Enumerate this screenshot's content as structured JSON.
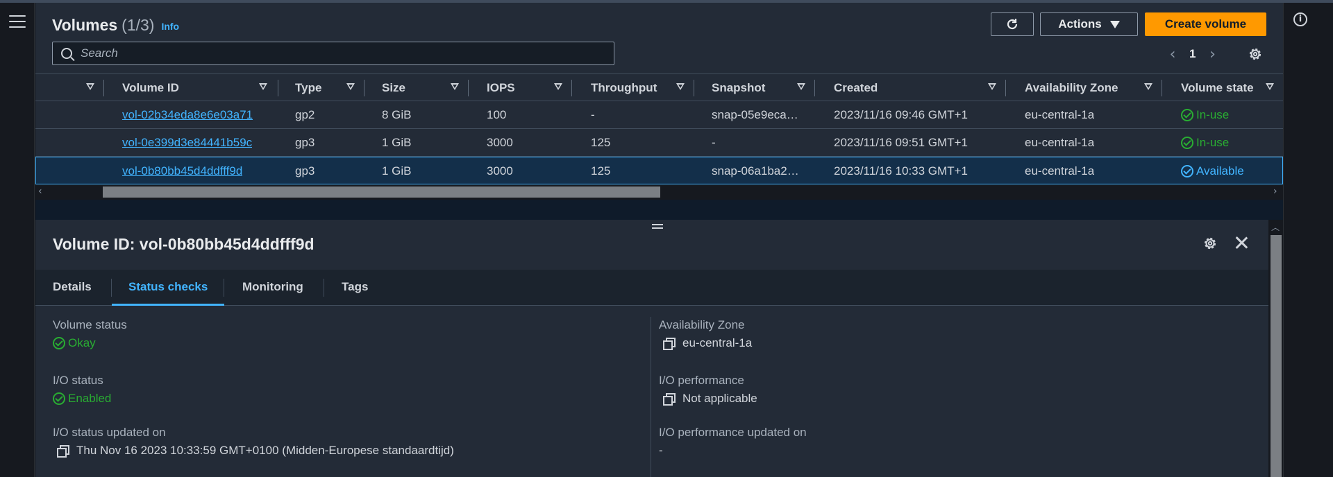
{
  "header": {
    "title": "Volumes",
    "count": "(1/3)",
    "info_label": "Info",
    "actions_label": "Actions",
    "create_label": "Create volume"
  },
  "search": {
    "placeholder": "Search"
  },
  "pagination": {
    "current_page": "1"
  },
  "table": {
    "columns": [
      "Volume ID",
      "Type",
      "Size",
      "IOPS",
      "Throughput",
      "Snapshot",
      "Created",
      "Availability Zone",
      "Volume state"
    ],
    "rows": [
      {
        "volume_id": "vol-02b34eda8e6e03a71",
        "type": "gp2",
        "size": "8 GiB",
        "iops": "100",
        "throughput": "-",
        "snapshot": "snap-05e9eca…",
        "created": "2023/11/16 09:46 GMT+1",
        "az": "eu-central-1a",
        "state": "In-use",
        "selected": false
      },
      {
        "volume_id": "vol-0e399d3e84441b59c",
        "type": "gp3",
        "size": "1 GiB",
        "iops": "3000",
        "throughput": "125",
        "snapshot": "-",
        "created": "2023/11/16 09:51 GMT+1",
        "az": "eu-central-1a",
        "state": "In-use",
        "selected": false
      },
      {
        "volume_id": "vol-0b80bb45d4ddfff9d",
        "type": "gp3",
        "size": "1 GiB",
        "iops": "3000",
        "throughput": "125",
        "snapshot": "snap-06a1ba2…",
        "created": "2023/11/16 10:33 GMT+1",
        "az": "eu-central-1a",
        "state": "Available",
        "selected": true
      }
    ]
  },
  "details": {
    "title": "Volume ID: vol-0b80bb45d4ddfff9d",
    "tabs": [
      "Details",
      "Status checks",
      "Monitoring",
      "Tags"
    ],
    "active_tab": "Status checks",
    "left": [
      {
        "label": "Volume status",
        "value": "Okay"
      },
      {
        "label": "I/O status",
        "value": "Enabled"
      },
      {
        "label": "I/O status updated on",
        "value": "Thu Nov 16 2023 10:33:59 GMT+0100 (Midden-Europese standaardtijd)"
      }
    ],
    "right": [
      {
        "label": "Availability Zone",
        "value": "eu-central-1a"
      },
      {
        "label": "I/O performance",
        "value": "Not applicable"
      },
      {
        "label": "I/O performance updated on",
        "value": "-"
      }
    ]
  },
  "colors": {
    "accent": "#42b4ff",
    "primary_button": "#ff9900",
    "success": "#29ad32"
  },
  "icons": [
    "menu-icon",
    "info-icon",
    "refresh-icon",
    "caret-down-icon",
    "search-icon",
    "chevron-left-icon",
    "chevron-right-icon",
    "settings-gear-icon",
    "sort-icon",
    "check-circle-icon",
    "copy-icon",
    "close-icon",
    "drag-handle-icon"
  ]
}
